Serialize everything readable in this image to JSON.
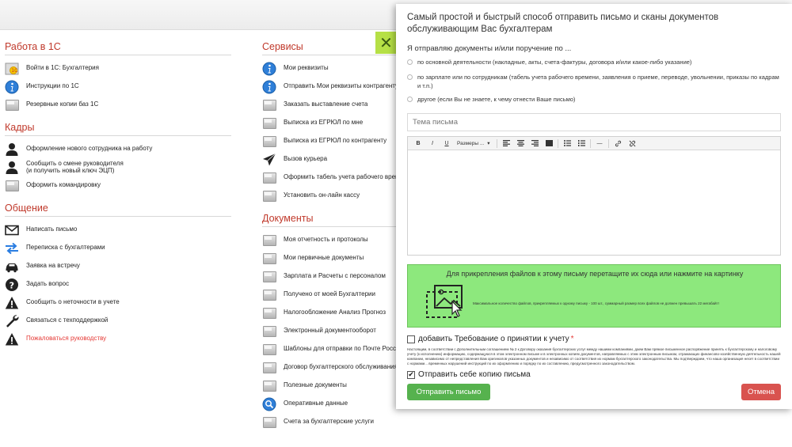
{
  "left_column": [
    {
      "title": "Работа в 1С",
      "items": [
        {
          "label": "Войти в 1С: Бухгалтерия",
          "icon": "1c-logo-icon"
        },
        {
          "label": "Инструкции по 1С",
          "icon": "info-icon"
        },
        {
          "label": "Резервные копии баз 1С",
          "icon": "folder-icon"
        }
      ]
    },
    {
      "title": "Кадры",
      "items": [
        {
          "label": "Оформление нового сотрудника на работу",
          "icon": "person-icon"
        },
        {
          "label": "Сообщить о смене руководителя",
          "label2": "(и получить новый ключ ЭЦП)",
          "icon": "person-icon"
        },
        {
          "label": "Оформить командировку",
          "icon": "folder-icon"
        }
      ]
    },
    {
      "title": "Общение",
      "items": [
        {
          "label": "Написать письмо",
          "icon": "envelope-icon"
        },
        {
          "label": "Переписка с бухгалтерами",
          "icon": "arrows-exchange-icon"
        },
        {
          "label": "Заявка на встречу",
          "icon": "car-icon"
        },
        {
          "label": "Задать вопрос",
          "icon": "question-icon"
        },
        {
          "label": "Сообщить о неточности в учете",
          "icon": "warning-icon"
        },
        {
          "label": "Связаться с техподдержкой",
          "icon": "wrench-icon"
        },
        {
          "label": "Пожаловаться руководству",
          "icon": "warning-icon",
          "red": true
        }
      ]
    }
  ],
  "right_column": [
    {
      "title": "Сервисы",
      "items": [
        {
          "label": "Мои реквизиты",
          "icon": "info-icon"
        },
        {
          "label": "Отправить Мои реквизиты контрагенту",
          "icon": "info-icon"
        },
        {
          "label": "Заказать выставление счета",
          "icon": "folder-icon"
        },
        {
          "label": "Выписка из ЕГРЮЛ по мне",
          "icon": "folder-icon"
        },
        {
          "label": "Выписка из ЕГРЮЛ по контрагенту",
          "icon": "folder-icon"
        },
        {
          "label": "Вызов курьера",
          "icon": "paper-plane-icon"
        },
        {
          "label": "Оформить табель учета рабочего времени",
          "icon": "folder-icon"
        },
        {
          "label": "Установить он-лайн кассу",
          "icon": "folder-icon"
        }
      ]
    },
    {
      "title": "Документы",
      "items": [
        {
          "label": "Моя отчетность и протоколы",
          "icon": "folder-icon"
        },
        {
          "label": "Мои первичные документы",
          "icon": "folder-icon"
        },
        {
          "label": "Зарплата и Расчеты с персоналом",
          "icon": "folder-icon"
        },
        {
          "label": "Получено от моей Бухгалтерии",
          "icon": "folder-icon"
        },
        {
          "label": "Налогообложение Анализ Прогноз",
          "icon": "folder-icon"
        },
        {
          "label": "Электронный документооборот",
          "icon": "folder-icon"
        },
        {
          "label": "Шаблоны для отправки по Почте России",
          "icon": "folder-icon"
        },
        {
          "label": "Договор бухгалтерского обслуживания",
          "icon": "folder-icon"
        },
        {
          "label": "Полезные документы",
          "icon": "folder-icon"
        },
        {
          "label": "Оперативные данные",
          "icon": "search-icon"
        },
        {
          "label": "Счета за бухгалтерские услуги",
          "icon": "folder-icon"
        }
      ]
    }
  ],
  "close_symbol": "✕",
  "modal": {
    "title": "Самый простой и быстрый способ отправить письмо и сканы документов обслуживающим Вас бухгалтерам",
    "subtitle": "Я отправляю документы и/или поручение по ...",
    "radios": [
      "по основной деятельности (накладные, акты, счета-фактуры, договора и/или какое-либо указание)",
      "по зарплате или по сотрудникам (табель учета рабочего времени, заявления о приеме, переводе, увольнении, приказы по кадрам и т.п.)",
      "другое (если Вы не знаете, к чему отнести Ваше письмо)"
    ],
    "subject_placeholder": "Тема письма",
    "toolbar": {
      "bold": "B",
      "italic": "I",
      "underline": "U",
      "size": "Размеры ...",
      "size_arrow": "▾",
      "hr": "—"
    },
    "dropzone": {
      "text": "Для прикрепления файлов к этому письму перетащите их сюда или нажмите на картинку",
      "limit": "Максимальное количество файлов, прикрепляемых к одному письму - 100 шт., суммарный размер всех файлов не должен превышать 22 мегабайт!"
    },
    "requirement_label": "добавить Требование о принятии к учету",
    "requirement_checked": false,
    "required_mark": "*",
    "legal_text": "Настоящим, в соответствии с Дополнительным соглашением № 2 к Договору оказания бухгалтерских услуг между нашими компаниями, даем Вам прямое письменное распоряжение принять к бухгалтерскому и налоговому учету (к исполнению) информацию, содержащуюся в этом электронном письме и в электронных копиях документов, направляемых с этим электронным письмом, отражающих финансово-хозяйственную деятельность нашей компании, независимо от непредставления Вам оригиналов указанных документов и независимо от соответствия их нормам бухгалтерского законодательства. Мы подтверждаем, что наша организация несет в соответствии с нормами... временных нарушений инструкций по их оформлению и порядку по их составлению, предусмотренного законодательством.",
    "copy_label": "Отправить себе копию письма",
    "copy_checked": true,
    "copy_check_mark": "✔",
    "send_label": "Отправить письмо",
    "cancel_label": "Отмена"
  }
}
